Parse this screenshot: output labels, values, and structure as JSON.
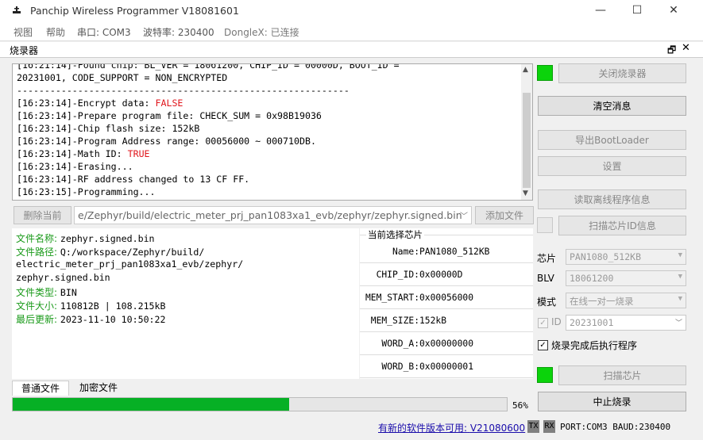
{
  "window": {
    "title": "Panchip Wireless Programmer V18081601",
    "controls": [
      "—",
      "☐",
      "✕"
    ]
  },
  "menu": {
    "view": "视图",
    "help": "帮助",
    "port": "串口: COM3",
    "baud": "波特率: 230400",
    "dongle": "DongleX: 已连接"
  },
  "panel": {
    "title": "烧录器",
    "pin_icon": "🗗",
    "close_icon": "✕"
  },
  "log_lines": [
    {
      "text": "[16:21:14]-Found chip: BL_VER = 18061200, CHIP_ID = 00000D, BOOT_ID =",
      "hl": ""
    },
    {
      "text": "20231001, CODE_SUPPORT = NON_ENCRYPTED",
      "hl": ""
    },
    {
      "text": "------------------------------------------------------------",
      "hl": ""
    },
    {
      "text": "[16:23:14]-Encrypt data: ",
      "hl": "FALSE"
    },
    {
      "text": "[16:23:14]-Prepare program file: CHECK_SUM = 0x98B19036",
      "hl": ""
    },
    {
      "text": "[16:23:14]-Chip flash size: 152kB",
      "hl": ""
    },
    {
      "text": "[16:23:14]-Program Address range: 00056000 ~ 000710DB.",
      "hl": ""
    },
    {
      "text": "[16:23:14]-Math ID: ",
      "hl": "TRUE"
    },
    {
      "text": "[16:23:14]-Erasing...",
      "hl": ""
    },
    {
      "text": "[16:23:14]-RF address changed to 13 CF FF.",
      "hl": ""
    },
    {
      "text": "[16:23:15]-Programming...",
      "hl": ""
    }
  ],
  "file_controls": {
    "delete_current": "删除当前",
    "path": "e/Zephyr/build/electric_meter_prj_pan1083xa1_evb/zephyr/zephyr.signed.bin",
    "add_file": "添加文件"
  },
  "file_info": {
    "name_label": "文件名称:",
    "name": "zephyr.signed.bin",
    "path_label": "文件路径:",
    "path_1": "Q:/workspace/Zephyr/build/",
    "path_2": "electric_meter_prj_pan1083xa1_evb/zephyr/",
    "path_3": "zephyr.signed.bin",
    "type_label": "文件类型:",
    "type": "BIN",
    "size_label": "文件大小:",
    "size": "110812B | 108.215kB",
    "updated_label": "最后更新:",
    "updated": "2023-11-10 10:50:22"
  },
  "chip_info": {
    "legend": "当前选择芯片",
    "rows": [
      {
        "key": "Name:",
        "value": "PAN1080_512KB"
      },
      {
        "key": "CHIP_ID:",
        "value": "0x00000D"
      },
      {
        "key": "MEM_START:",
        "value": "0x00056000"
      },
      {
        "key": "MEM_SIZE:",
        "value": "152kB"
      },
      {
        "key": "WORD_A:",
        "value": "0x00000000"
      },
      {
        "key": "WORD_B:",
        "value": "0x00000001"
      }
    ]
  },
  "tabs": {
    "normal": "普通文件",
    "encrypted": "加密文件"
  },
  "progress": {
    "fraction": 0.56,
    "label": "56%"
  },
  "right_panel": {
    "close_programmer": "关闭烧录器",
    "clear_messages": "清空消息",
    "export_bootloader": "导出BootLoader",
    "settings": "设置",
    "read_offline": "读取离线程序信息",
    "scan_chip_id": "扫描芯片ID信息",
    "chip_label": "芯片",
    "chip_value": "PAN1080_512KB",
    "blv_label": "BLV",
    "blv_value": "18061200",
    "mode_label": "模式",
    "mode_value": "在线一对一烧录",
    "id_label": "ID",
    "id_value": "20231001",
    "run_after_label": "烧录完成后执行程序",
    "scan_chip": "扫描芯片",
    "abort_programming": "中止烧录"
  },
  "status": {
    "update_text": "有新的软件版本可用:",
    "update_version": "V21080600",
    "tx": "TX",
    "rx": "RX",
    "port_info": "PORT:COM3 BAUD:230400"
  },
  "colors": {
    "progress_fill": "#06b025",
    "led_on": "#0bd30b",
    "log_highlight": "#e0161c",
    "file_key": "#1a9a1a",
    "link": "#1a0dab"
  }
}
